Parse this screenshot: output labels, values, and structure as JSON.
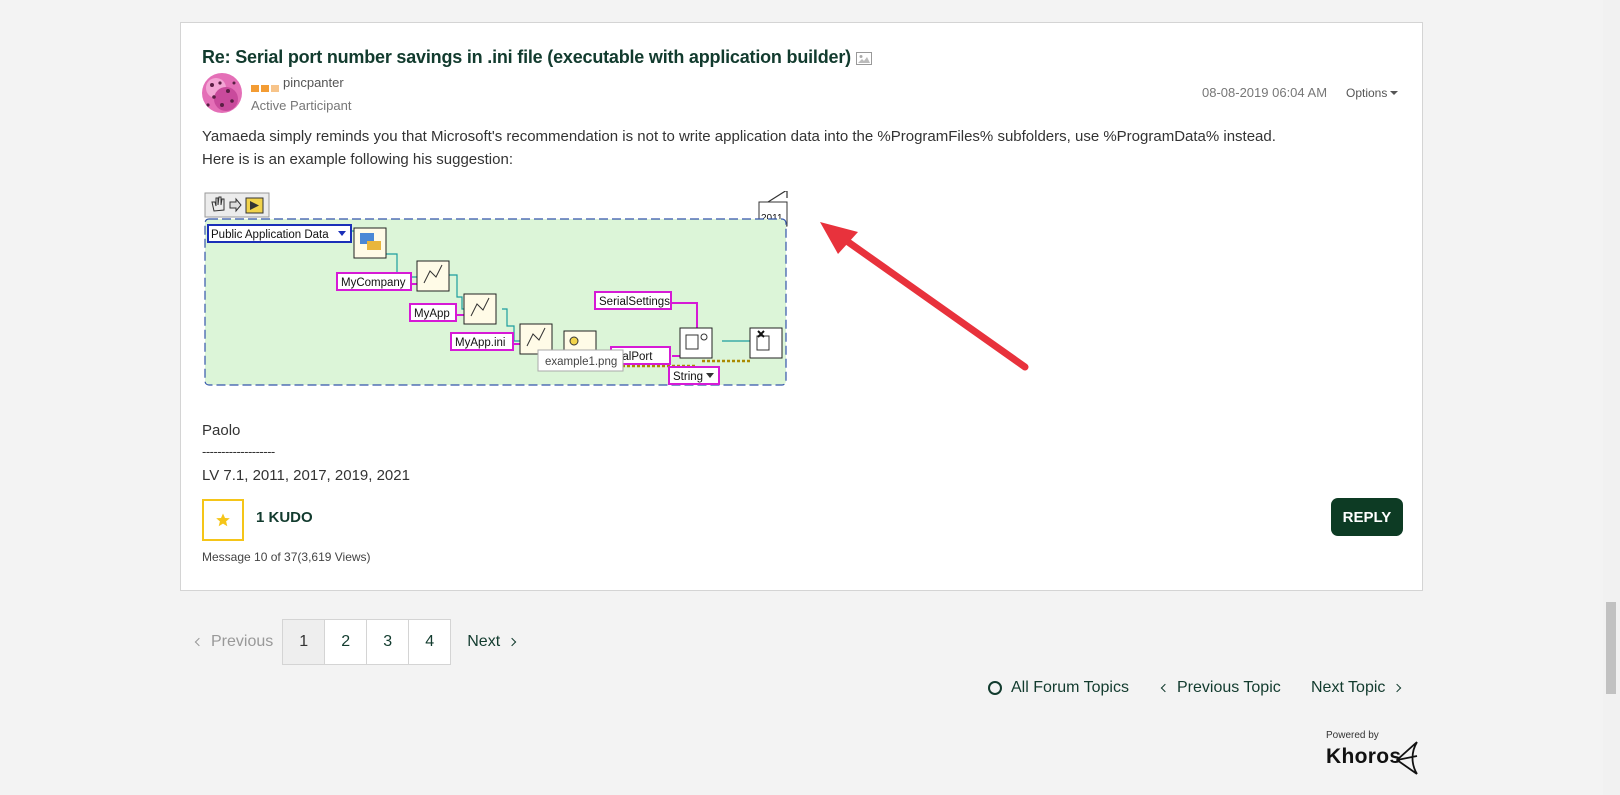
{
  "post": {
    "title": "Re: Serial port number savings in .ini file (executable with application builder)",
    "author": "pincpanter",
    "rank": "Active Participant",
    "timestamp": "08-08-2019 06:04 AM",
    "options_label": "Options",
    "body_line1": "Yamaeda simply reminds you that Microsoft's recommendation is not to write application data into the %ProgramFiles% subfolders, use %ProgramData% instead.",
    "body_line2": "Here is is an example following his suggestion:",
    "signature_name": "Paolo",
    "signature_dashes": "-------------------",
    "signature_versions": "LV 7.1, 2011, 2017, 2019, 2021",
    "kudo_label": "1 KUDO",
    "reply_label": "REPLY",
    "message_info": "Message 10 of 37(3,619 Views)"
  },
  "image": {
    "version_badge": "2011",
    "enum_value": "Public Application Data",
    "labels": [
      "MyCompany",
      "MyApp",
      "MyApp.ini",
      "SerialSettings",
      "rialPort"
    ],
    "string_dropdown": "String",
    "tooltip": "example1.png"
  },
  "colors": {
    "brand_green": "#0d3b24",
    "title_green": "#123b2e",
    "kudo_yellow": "#f5c518",
    "arrow_red": "#e8323c",
    "diagram_bg": "#dcf5d8",
    "label_pink": "#d61ad6"
  },
  "pagination": {
    "previous": "Previous",
    "pages": [
      "1",
      "2",
      "3",
      "4"
    ],
    "active_page": "1",
    "next": "Next"
  },
  "topic_nav": {
    "all_topics": "All Forum Topics",
    "previous_topic": "Previous Topic",
    "next_topic": "Next Topic"
  },
  "footer": {
    "powered_by": "Powered by",
    "brand": "Khoros"
  }
}
